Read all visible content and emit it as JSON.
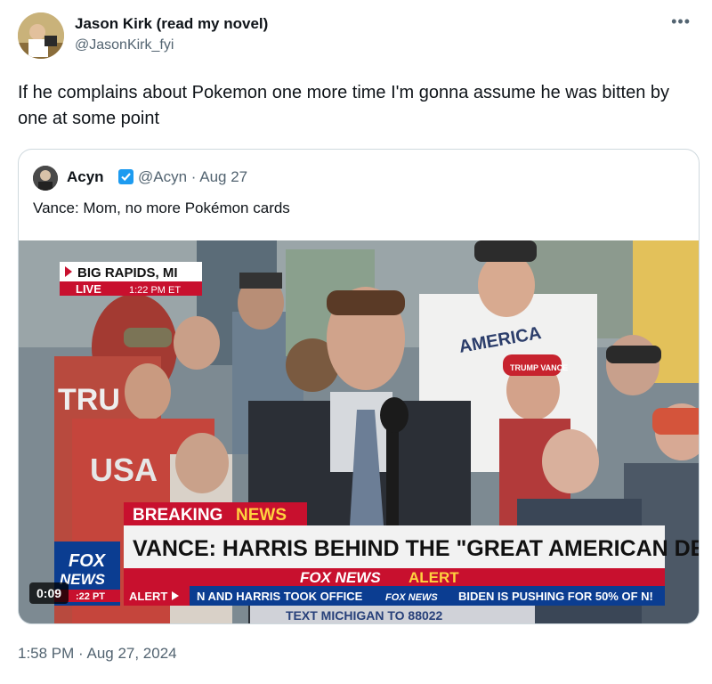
{
  "tweet": {
    "author_name": "Jason Kirk (read my novel)",
    "author_handle": "@JasonKirk_fyi",
    "more_icon": "•••",
    "text": "If he complains about Pokemon one more time I'm gonna assume he was bitten by one at some point",
    "timestamp": "1:58 PM · Aug 27, 2024"
  },
  "quoted": {
    "author_name": "Acyn",
    "author_handle": "@Acyn",
    "date": "· Aug 27",
    "text": "Vance: Mom, no more Pokémon cards",
    "verified_color": "#1d9bf0"
  },
  "video": {
    "duration": "0:09",
    "location": "BIG RAPIDS, MI",
    "live_label": "LIVE",
    "live_time": "1:22 PM ET",
    "breaking": "BREAKING",
    "news": "NEWS",
    "headline": "VANCE: HARRIS BEHIND THE \"GREAT AMERICAN DECLINE\"",
    "alert_brand": "FOX NEWS",
    "alert_word": "ALERT",
    "ticker_label": "ALERT",
    "ticker_text_1": "N AND HARRIS TOOK OFFICE",
    "ticker_brand": "FOX NEWS",
    "ticker_text_2": "BIDEN IS PUSHING FOR 50% OF N!",
    "logo_line1": "FOX",
    "logo_line2": "NEWS",
    "logo_time": ":22 PT",
    "bottom_text": "TEXT MICHIGAN TO 88022",
    "shirt_text_1": "AMERICA",
    "shirt_text_2": "USA",
    "shirt_text_3": "TRU",
    "hat_text": "TRUMP VANCE",
    "colors": {
      "fox_red": "#c8102e",
      "fox_blue": "#0b3d91",
      "banner_white": "#f2f2f2"
    }
  }
}
